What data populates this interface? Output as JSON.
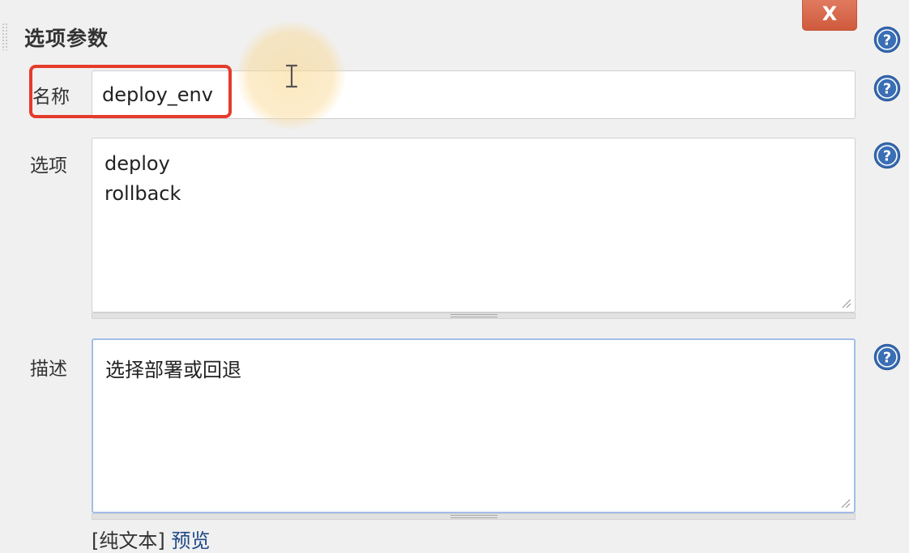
{
  "section": {
    "title": "选项参数",
    "close_label": "X"
  },
  "fields": {
    "name": {
      "label": "名称",
      "value": "deploy_env"
    },
    "choices": {
      "label": "选项",
      "lines": [
        "deploy",
        "rollback"
      ]
    },
    "description": {
      "label": "描述",
      "value": "选择部署或回退"
    }
  },
  "footer": {
    "plain_text": "[纯文本]",
    "preview": "预览"
  },
  "icons": {
    "help": "help-icon",
    "close": "close-icon",
    "cursor": "text-cursor-icon"
  },
  "colors": {
    "close_button": "#d9654a",
    "highlight": "#e53b2c",
    "help_icon": "#3a6eb5",
    "focus_border": "#a3bde8"
  }
}
